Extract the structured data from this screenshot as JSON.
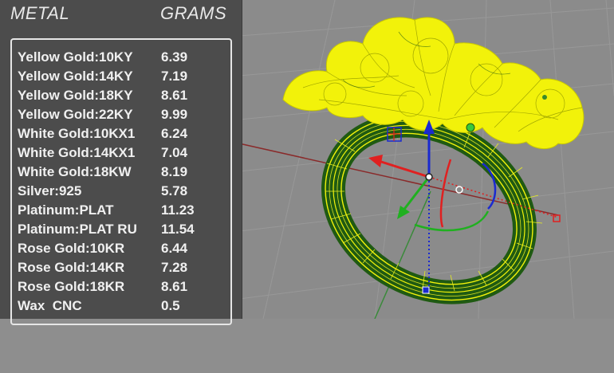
{
  "header": {
    "metal_label": "METAL",
    "grams_label": "GRAMS"
  },
  "rows": [
    {
      "metal": "Yellow Gold:10KY",
      "grams": "6.39"
    },
    {
      "metal": "Yellow Gold:14KY",
      "grams": "7.19"
    },
    {
      "metal": "Yellow Gold:18KY",
      "grams": "8.61"
    },
    {
      "metal": "Yellow Gold:22KY",
      "grams": "9.99"
    },
    {
      "metal": "White Gold:10KX1",
      "grams": "6.24"
    },
    {
      "metal": "White Gold:14KX1",
      "grams": "7.04"
    },
    {
      "metal": "White Gold:18KW",
      "grams": "8.19"
    },
    {
      "metal": "Silver:925",
      "grams": "5.78"
    },
    {
      "metal": "Platinum:PLAT",
      "grams": "11.23"
    },
    {
      "metal": "Platinum:PLAT RU",
      "grams": "11.54"
    },
    {
      "metal": "Rose Gold:10KR",
      "grams": "6.44"
    },
    {
      "metal": "Rose Gold:14KR",
      "grams": "7.28"
    },
    {
      "metal": "Rose Gold:18KR",
      "grams": "8.61"
    },
    {
      "metal": "Wax  CNC",
      "grams": "0.5"
    }
  ],
  "colors": {
    "viewport_bg": "#8b8b8b",
    "panel_bg": "#4c4c4c",
    "wireframe": "#f2f20a",
    "ring_band": "#1f5a12",
    "axis_x": "#e02020",
    "axis_y": "#20b020",
    "axis_z": "#1a2ad0"
  },
  "icons": [
    "gumball-widget",
    "wireframe-ring-model"
  ]
}
